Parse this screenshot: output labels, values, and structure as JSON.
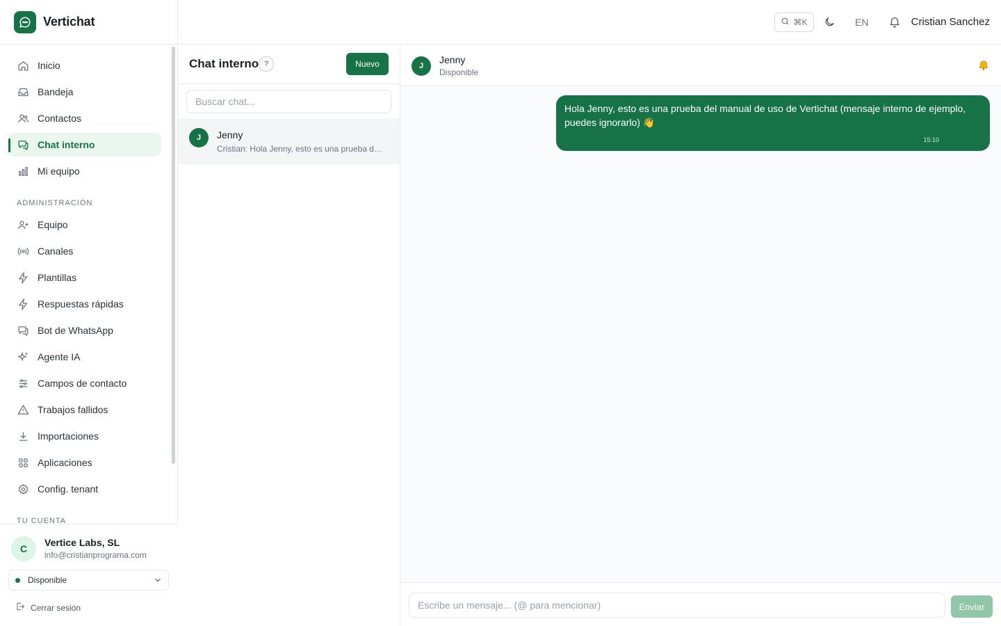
{
  "app": {
    "name": "Vertichat"
  },
  "sidebar": {
    "items": [
      {
        "label": "Inicio",
        "icon": "home-icon"
      },
      {
        "label": "Bandeja",
        "icon": "inbox-icon"
      },
      {
        "label": "Contactos",
        "icon": "users-icon"
      },
      {
        "label": "Chat interno",
        "icon": "chat-bubbles-icon",
        "active": true
      },
      {
        "label": "Mi equipo",
        "icon": "bar-chart-icon"
      }
    ],
    "admin_section_label": "ADMINISTRACIÓN",
    "admin_items": [
      {
        "label": "Equipo",
        "icon": "user-plus-icon"
      },
      {
        "label": "Canales",
        "icon": "broadcast-icon"
      },
      {
        "label": "Plantillas",
        "icon": "lightning-icon"
      },
      {
        "label": "Respuestas rápidas",
        "icon": "lightning-icon"
      },
      {
        "label": "Bot de WhatsApp",
        "icon": "chat-bubbles-icon"
      },
      {
        "label": "Agente IA",
        "icon": "sparkles-icon"
      },
      {
        "label": "Campos de contacto",
        "icon": "sliders-icon"
      },
      {
        "label": "Trabajos fallidos",
        "icon": "warning-icon"
      },
      {
        "label": "Importaciones",
        "icon": "download-icon"
      },
      {
        "label": "Aplicaciones",
        "icon": "grid-icon"
      },
      {
        "label": "Config. tenant",
        "icon": "gear-icon"
      }
    ],
    "account_section_label": "TU CUENTA"
  },
  "account": {
    "avatar_initial": "C",
    "name": "Vertice Labs, SL",
    "email": "info@cristianprograma.com",
    "status": "Disponible",
    "logout_label": "Cerrar sesión"
  },
  "header": {
    "search_shortcut": "⌘K",
    "language": "EN",
    "user_name": "Cristian Sanchez"
  },
  "chat_list": {
    "title": "Chat interno",
    "help": "?",
    "new_button": "Nuevo",
    "search_placeholder": "Buscar chat...",
    "items": [
      {
        "initial": "J",
        "name": "Jenny",
        "preview": "Cristian: Hola Jenny, esto es una prueba del manual de uso de Vertichat"
      }
    ]
  },
  "conversation": {
    "initial": "J",
    "name": "Jenny",
    "status": "Disponible",
    "messages": [
      {
        "text": "Hola Jenny, esto es una prueba del manual de uso de Vertichat (mensaje interno de ejemplo, puedes ignorarlo) 👋",
        "time": "15:10",
        "outgoing": true
      }
    ],
    "composer_placeholder": "Escribe un mensaje... (@ para mencionar)",
    "send_label": "Enviar"
  },
  "colors": {
    "brand": "#157347",
    "brand_light": "#e9f7ee",
    "send_disabled": "#92c6a8"
  }
}
